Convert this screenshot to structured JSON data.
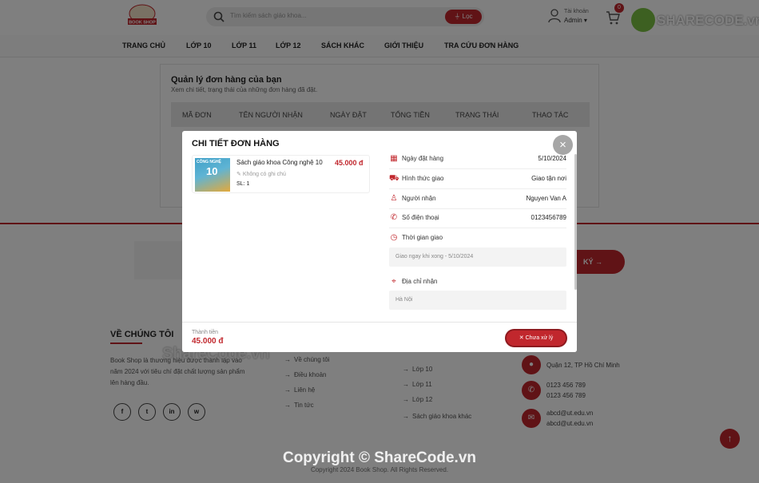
{
  "header": {
    "logo_text": "BOOK SHOP",
    "search_placeholder": "Tìm kiếm sách giáo khoa...",
    "filter_label": "Lọc",
    "account_label": "Tài khoản",
    "account_name": "Admin",
    "cart_count": "0",
    "brand_watermark": "SHARECODE.vn"
  },
  "nav": [
    "TRANG CHỦ",
    "LỚP 10",
    "LỚP 11",
    "LỚP 12",
    "SÁCH KHÁC",
    "GIỚI THIỆU",
    "TRA CỨU ĐƠN HÀNG"
  ],
  "orders": {
    "title": "Quản lý đơn hàng của bạn",
    "subtitle": "Xem chi tiết, trạng thái của những đơn hàng đã đặt.",
    "columns": [
      "MÃ ĐƠN",
      "TÊN NGƯỜI NHẬN",
      "NGÀY ĐẶT",
      "TỔNG TIỀN",
      "TRẠNG THÁI",
      "THAO TÁC"
    ]
  },
  "newsletter": {
    "button_label": "KÝ"
  },
  "footer": {
    "about_title": "VỀ CHÚNG TÔI",
    "about_text": "Book Shop là thương hiệu được thành lập vào năm 2024 với tiêu chí đặt chất lượng sản phẩm lên hàng đầu.",
    "socials": [
      "f",
      "t",
      "in",
      "w"
    ],
    "links": [
      "Về chúng tôi",
      "Điều khoản",
      "Liên hệ",
      "Tin tức"
    ],
    "categories": [
      "Lớp 10",
      "Lớp 11",
      "Lớp 12",
      "Sách giáo khoa khác"
    ],
    "contact": {
      "address": "Quận 12, TP Hồ Chí Minh",
      "phones": [
        "0123 456 789",
        "0123 456 789"
      ],
      "emails": [
        "abcd@ut.edu.vn",
        "abcd@ut.edu.vn"
      ]
    },
    "copyright": "Copyright 2024 Book Shop. All Rights Reserved."
  },
  "watermarks": {
    "left": "ShareCode.vn",
    "bottom": "Copyright © ShareCode.vn"
  },
  "modal": {
    "title": "CHI TIẾT ĐƠN HÀNG",
    "close": "×",
    "product": {
      "cover_caption": "CÔNG NGHỆ",
      "cover_number": "10",
      "name": "Sách giáo khoa Công nghệ 10",
      "price": "45.000 đ",
      "note": "Không có ghi chú",
      "qty": "SL: 1"
    },
    "order_date_label": "Ngày đặt hàng",
    "order_date": "5/10/2024",
    "delivery_label": "Hình thức giao",
    "delivery": "Giao tận nơi",
    "receiver_label": "Người nhận",
    "receiver": "Nguyen Van A",
    "phone_label": "Số điện thoại",
    "phone": "0123456789",
    "delivery_time_label": "Thời gian giao",
    "delivery_time": "Giao ngay khi xong - 5/10/2024",
    "address_label": "Địa chỉ nhận",
    "address": "Hà Nội",
    "total_label": "Thành tiền",
    "total": "45.000 đ",
    "status_button": "Chưa xử lý"
  }
}
